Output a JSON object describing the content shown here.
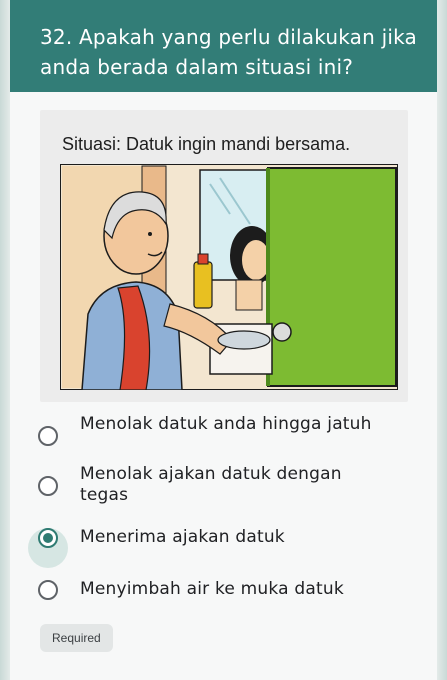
{
  "question": {
    "title": "32. Apakah yang perlu dilakukan jika anda berada dalam situasi ini?"
  },
  "illustration": {
    "caption": "Situasi: Datuk ingin mandi bersama."
  },
  "options": [
    {
      "label": "Menolak datuk anda hingga jatuh",
      "selected": false
    },
    {
      "label": "Menolak ajakan datuk dengan tegas",
      "selected": false
    },
    {
      "label": "Menerima ajakan datuk",
      "selected": true
    },
    {
      "label": "Menyimbah air ke muka datuk",
      "selected": false
    }
  ],
  "required_label": "Required",
  "colors": {
    "header": "#327d77",
    "accent": "#2f7b72",
    "door": "#7dbb32"
  }
}
